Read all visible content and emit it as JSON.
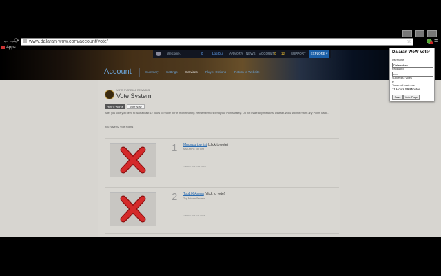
{
  "browser": {
    "back_glyph": "←",
    "forward_glyph": "→",
    "reload_glyph": "⟳",
    "url": "www.dalaran-wow.com/account/vote/",
    "star_glyph": "☆",
    "bookmarks_apps": "Apps",
    "menu_glyph": "≡"
  },
  "site_nav": {
    "welcome": "Welcome,",
    "count": "0",
    "logout": "Log Out",
    "armory": "ARMORY",
    "news": "NEWS",
    "account": "ACCOUNT",
    "badge1": "0",
    "badge2": "12",
    "support": "SUPPORT",
    "explore": "EXPLORE ▾"
  },
  "account_header": {
    "title": "Account",
    "tabs": [
      "Summary",
      "Settings",
      "Services",
      "Player Options",
      "Return to Website"
    ]
  },
  "vote_system": {
    "kicker": "VOTE SYSTEM & REWARDS",
    "title": "Vote System",
    "how_button": "How it Works",
    "vote_button": "Vote Now",
    "description": "After you vote you need to wait atleast 12 hours to revote per IP from revoting. Remember to spend your Points wisely. Do not make any mistakes, Dalaran-WoW will not return any Points back...",
    "points": "You have 92 Vote Points"
  },
  "vote_cards": [
    {
      "number": "1",
      "link": "Mmorpg top list",
      "suffix": "(click to vote)",
      "subtitle": "MMORPG Top List",
      "note": "You can vote in 11 hours"
    },
    {
      "number": "2",
      "link": "Top100Arena",
      "suffix": "(click to vote)",
      "subtitle": "Top Private Servers",
      "note": "You can vote in 9 hours"
    }
  ],
  "popup": {
    "title": "Dalaran WoW Voter",
    "username_label": "Username",
    "username_value": "Dalaranfree",
    "password_label": "Password",
    "password_value": "•••••",
    "successful_label": "Successful Votes",
    "successful_value": "0",
    "time_label": "Time until next vote",
    "time_value": "11 Hours 59 Minutes",
    "save": "Save",
    "vote_page": "Vote Page"
  },
  "colors": {
    "link": "#2a6bb0",
    "account_title": "#6ba3d6",
    "explore_bg": "#1a5fa8",
    "error_x": "#d42a2a"
  }
}
